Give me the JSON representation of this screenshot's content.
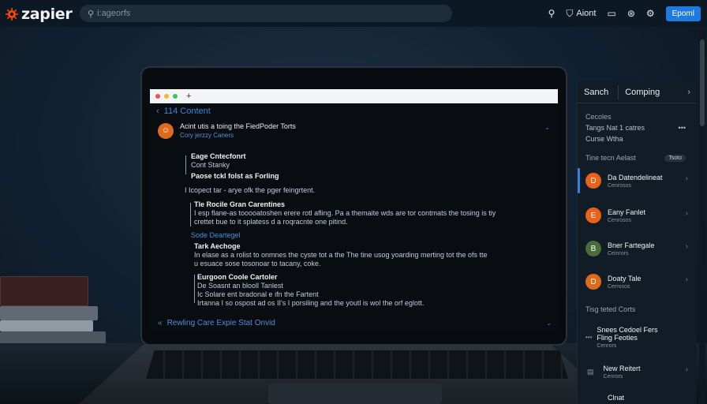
{
  "header": {
    "logo_text": "zapier",
    "search_placeholder": "i:ageorfs",
    "account_label": "Aiont",
    "primary_button": "Epoml",
    "icons": [
      "search-icon",
      "shield-icon",
      "card-icon",
      "share-icon",
      "gear-icon"
    ]
  },
  "screen": {
    "breadcrumb": "114 Content",
    "card": {
      "title": "Acint utis a toing the FiedPoder Torts",
      "subtitle": "Cory jerzzy Caners"
    },
    "blocks": {
      "b1_heading": "Eage Cntecfonrt",
      "b1_line1": "Cont Stanky",
      "b1_line2": "Paose tckl folst as Forling",
      "b1_body": "I Icopect tar - arye ofk the pger feingrtent.",
      "b2_heading": "Tle Rocile Gran Carentines",
      "b2_body1": "I esp flane-as tooooatoshen erere rotl afling. Pa a themaite wds are tor contmats the tosing is tiy",
      "b2_body2": "crettet bue to it splatess d a roqracnte one pitind.",
      "b3_link": "Sode Deartegel",
      "b3_heading": "Tark Aechoge",
      "b3_body1": "In elase as a rolist to onmnes the cyste tot a the The tine usog yoarding merting tot the ofs tte",
      "b3_body2": "u esuace sose tosonoar to tacany, coke.",
      "b4_heading": "Eurgoon Coole Cartoler",
      "b4_line1": "De Soasnt an blooll Tanlest",
      "b4_line2": "Ic Solare ent bradonal e ifn the Fartent",
      "b4_body": "Irtanna I so ospost ad os II's I porsiling and the youtl is wol the orf eglott."
    },
    "footer_link": "Rewling Care Expie Stat Onvid"
  },
  "panel": {
    "tabs": [
      "Sanch",
      "Comping"
    ],
    "section1_title": "Cecoles",
    "row1_text": "Tangs Nat 1 catres",
    "row2_text": "Curse Wtha",
    "section2_title": "Tine tecn Aelast",
    "pill": "Tsoto",
    "items": [
      {
        "name": "Da Datendelineat",
        "meta": "Cenrosos",
        "color": "#e8621a",
        "initial": "D"
      },
      {
        "name": "Eany Fanlet",
        "meta": "Cenrosos",
        "color": "#e8621a",
        "initial": "E"
      },
      {
        "name": "Bner Fartegale",
        "meta": "Ceinrors",
        "color": "#4a6b3a",
        "initial": "B"
      },
      {
        "name": "Doaty Tale",
        "meta": "Cerrosos",
        "color": "#e06a1c",
        "initial": "D"
      }
    ],
    "section3_title": "Tisg teted Corts",
    "items2": [
      {
        "name": "Snees Cedoel Fers",
        "name2": "Fling Feoties",
        "meta": "Cenrors"
      },
      {
        "name": "New Reitert",
        "meta": "Cenrors"
      },
      {
        "name": "Clnat",
        "meta": ""
      }
    ]
  },
  "colors": {
    "accent": "#1f7ae0",
    "orange": "#e8621a",
    "link": "#4a8fdb"
  }
}
